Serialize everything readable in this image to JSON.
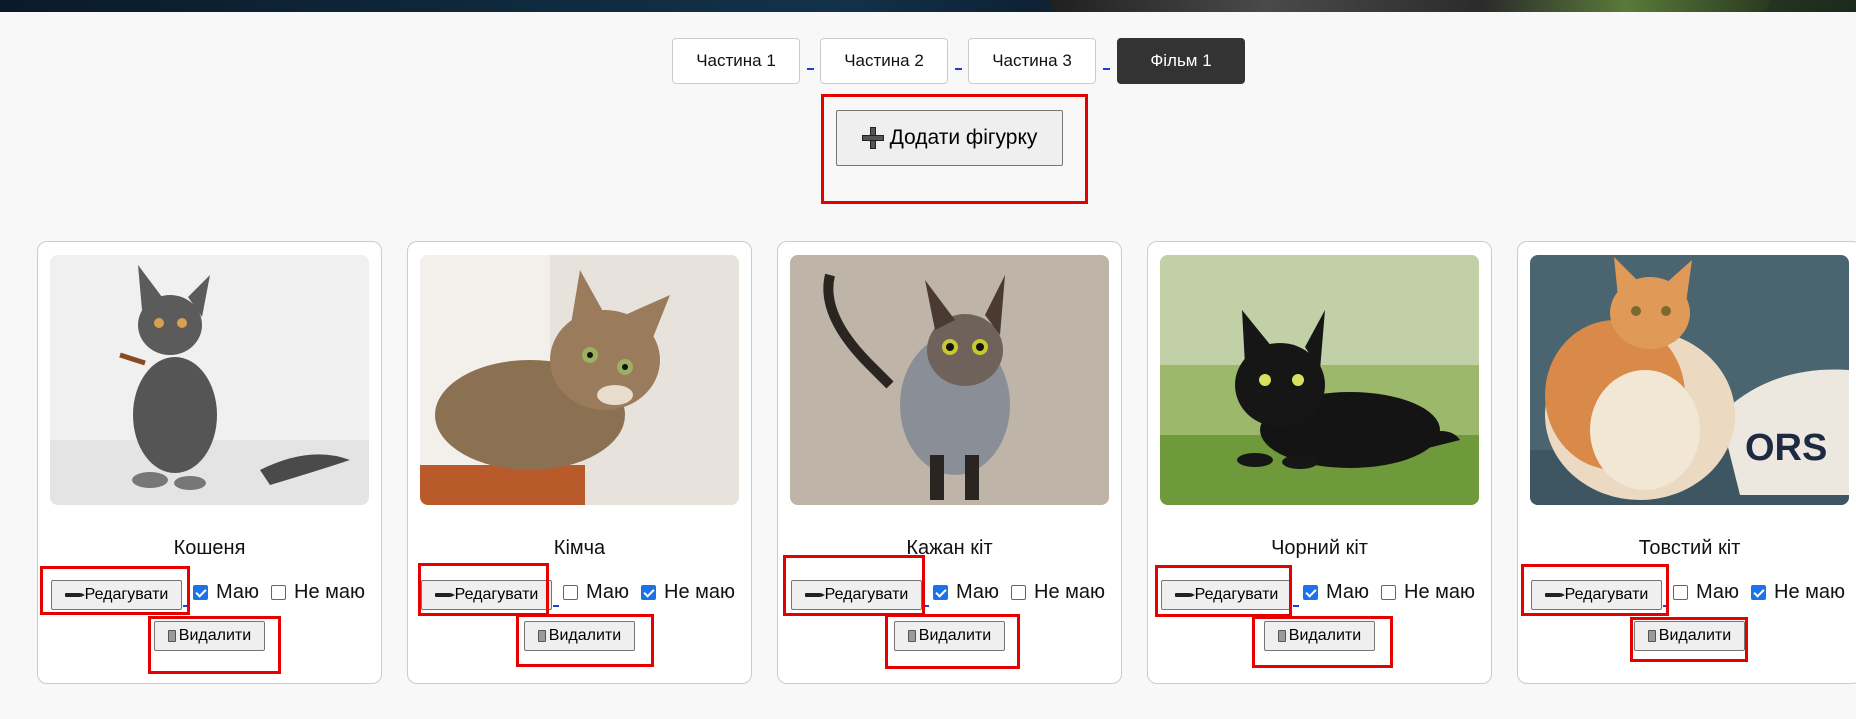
{
  "tabs": [
    {
      "label": "Частина 1",
      "active": false
    },
    {
      "label": "Частина 2",
      "active": false
    },
    {
      "label": "Частина 3",
      "active": false
    },
    {
      "label": "Фільм 1",
      "active": true
    }
  ],
  "add_button": {
    "label": "Додати фігурку",
    "icon": "plus-icon"
  },
  "cards": [
    {
      "name": "Кошеня",
      "edit_label": "Редагувати",
      "have_label": "Маю",
      "have": true,
      "not_have_label": "Не маю",
      "not_have": false,
      "delete_label": "Видалити"
    },
    {
      "name": "Кімча",
      "edit_label": "Редагувати",
      "have_label": "Маю",
      "have": false,
      "not_have_label": "Не маю",
      "not_have": true,
      "delete_label": "Видалити"
    },
    {
      "name": "Кажан кіт",
      "edit_label": "Редагувати",
      "have_label": "Маю",
      "have": true,
      "not_have_label": "Не маю",
      "not_have": false,
      "delete_label": "Видалити"
    },
    {
      "name": "Чорний кіт",
      "edit_label": "Редагувати",
      "have_label": "Маю",
      "have": true,
      "not_have_label": "Не маю",
      "not_have": false,
      "delete_label": "Видалити"
    },
    {
      "name": "Товстий кіт",
      "edit_label": "Редагувати",
      "have_label": "Маю",
      "have": false,
      "not_have_label": "Не маю",
      "not_have": true,
      "delete_label": "Видалити"
    }
  ],
  "colors": {
    "highlight": "#e60000",
    "active_tab": "#333333",
    "checkbox_checked": "#1a73e8"
  }
}
